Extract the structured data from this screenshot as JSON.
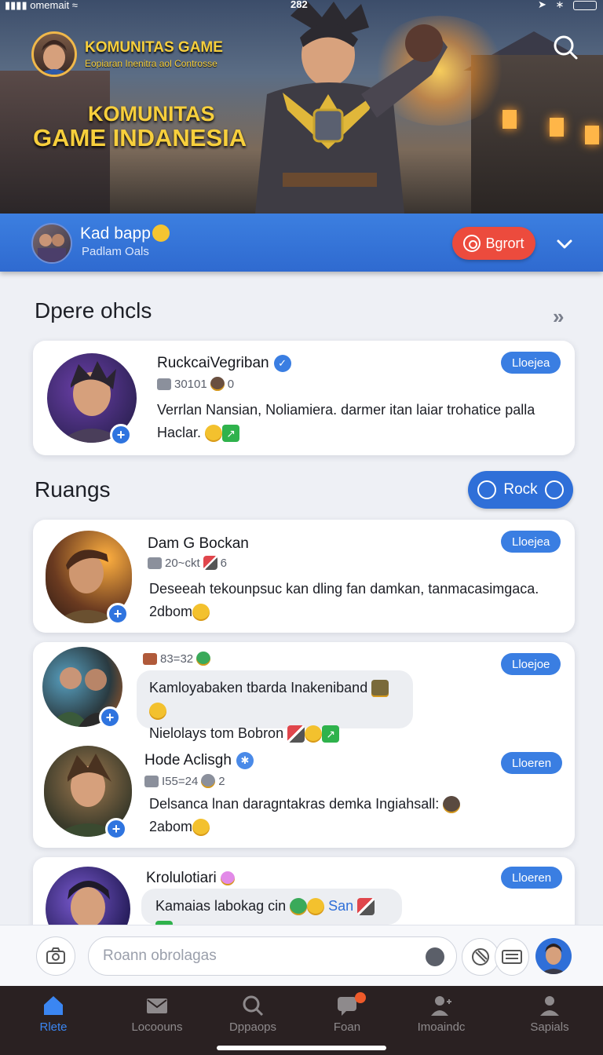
{
  "status_bar": {
    "carrier": "omemait",
    "time": "282"
  },
  "hero": {
    "community_title": "KOMUNITAS GAME",
    "community_subtitle": "Eopiaran Inenitra aol Controsse",
    "title_line1": "KOMUNITAS",
    "title_line2": "GAME INDANESIA"
  },
  "group_bar": {
    "name": "Kad bapp",
    "subtitle": "Padlam Oals",
    "report_label": "Bgrort"
  },
  "section_pinned": {
    "title": "Dpere ohcls",
    "more_symbol": "»"
  },
  "pinned_post": {
    "username": "RuckcaiVegriban",
    "meta": "30101",
    "meta2": "0",
    "pill": "Lloejea",
    "message_line1": "Verrlan Nansian, Noliamiera. darmer itan laiar trohatice palla",
    "message_line2": "Haclar."
  },
  "section_rooms": {
    "title": "Ruangs",
    "button_label": "Rock"
  },
  "posts": [
    {
      "username": "Dam G Bockan",
      "meta": "20~ckt",
      "meta2": "6",
      "pill": "Lloejea",
      "message_line1": "Deseeah tekounpsuc kan dling fan damkan, tanmacasimgaca.",
      "message_line2": "2dbom"
    },
    {
      "meta": "83=32",
      "pill": "Lloejoe",
      "bubble_line1": "Kamloyabaken tbarda Inakeniband",
      "bubble_line2": "Nielolays tom Bobron"
    },
    {
      "username": "Hode Aclisgh",
      "meta": "I55=24",
      "meta2": "2",
      "pill": "Lloeren",
      "message_line1": "Delsanca lnan daragntakras demka Ingiahsall:",
      "message_line2": "2abom"
    },
    {
      "username": "Krolulotiari",
      "pill": "Lloeren",
      "bubble_text": "Kamaias labokag cin",
      "bubble_tag": "San"
    }
  ],
  "composer": {
    "placeholder": "Roann obrolagas"
  },
  "tabs": [
    {
      "label": "Rlete",
      "icon": "home-icon",
      "active": true
    },
    {
      "label": "Locoouns",
      "icon": "mail-icon"
    },
    {
      "label": "Dppaops",
      "icon": "search-icon"
    },
    {
      "label": "Foan",
      "icon": "chat-icon"
    },
    {
      "label": "Imoaindc",
      "icon": "person-add-icon"
    },
    {
      "label": "Sapials",
      "icon": "profile-icon"
    }
  ],
  "colors": {
    "accent": "#2f6fd8",
    "report": "#ec4b3d",
    "hero_text": "#f7cf3c",
    "tabbar": "#2a2122"
  }
}
